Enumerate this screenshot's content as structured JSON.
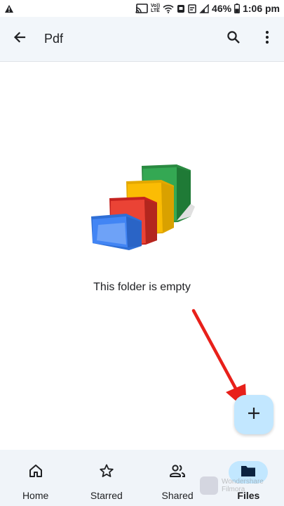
{
  "status_bar": {
    "alert_icon": "warning-triangle-icon",
    "volte_top": "Vo))",
    "volte_bottom": "LTE",
    "battery_percent": "46%",
    "time": "1:06 pm"
  },
  "app_bar": {
    "title": "Pdf",
    "back_icon": "arrow-back-icon",
    "search_icon": "search-icon",
    "more_icon": "more-vert-icon"
  },
  "empty_state": {
    "message": "This folder is empty",
    "illustration": "empty-folders-illustration"
  },
  "fab": {
    "icon": "plus-icon",
    "color": "#c2e7ff"
  },
  "bottom_nav": {
    "items": [
      {
        "label": "Home",
        "icon": "home-icon",
        "active": false
      },
      {
        "label": "Starred",
        "icon": "star-outline-icon",
        "active": false
      },
      {
        "label": "Shared",
        "icon": "people-icon",
        "active": false
      },
      {
        "label": "Files",
        "icon": "folder-icon",
        "active": true
      }
    ]
  },
  "watermark": {
    "line1": "Wondershare",
    "line2": "Filmora"
  },
  "colors": {
    "app_bar_bg": "#f2f6fa",
    "nav_bg": "#f0f4f9",
    "active_pill": "#c2e7ff",
    "annotation_arrow": "#e8201a",
    "folder_blue": "#4285f4",
    "folder_red": "#ea4335",
    "folder_yellow": "#fbbc04",
    "folder_green": "#34a853"
  }
}
